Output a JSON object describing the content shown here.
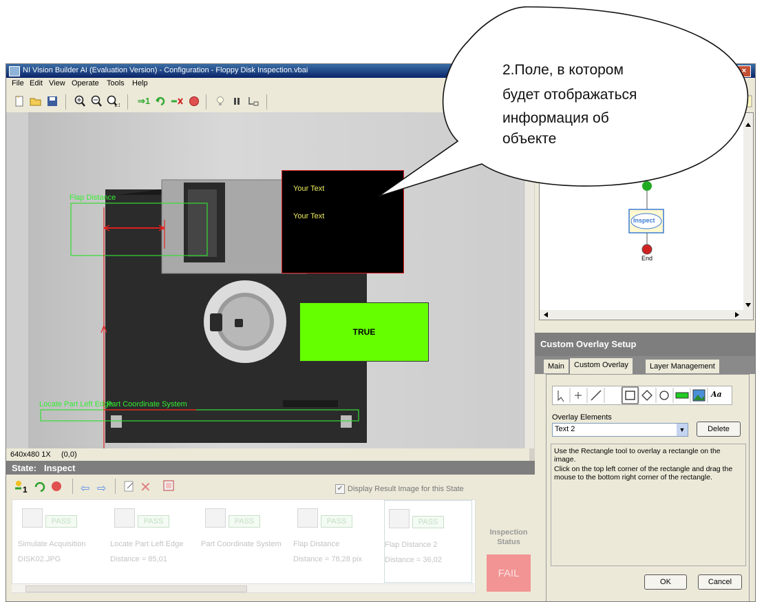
{
  "window": {
    "title": "NI Vision Builder AI (Evaluation Version) - Configuration - Floppy Disk Inspection.vbai",
    "close": "×"
  },
  "menu": [
    "File",
    "Edit",
    "View",
    "Operate",
    "Tools",
    "Help"
  ],
  "toolbar": {
    "icons": [
      "new-icon",
      "open-icon",
      "save-icon",
      "zoom-in-icon",
      "zoom-out-icon",
      "zoom-1to1-icon",
      "run-once-icon",
      "run-continuous-icon",
      "run-selected-icon",
      "stop-icon",
      "light-icon",
      "pause-icon",
      "step-icon",
      "help-icon"
    ],
    "run_label": "⇒1"
  },
  "overlay": {
    "flap_distance_label": "Flap Distance",
    "locate_label": "Locate Part Left Edge",
    "coordinate_label": "Part Coordinate System",
    "text_box_line1": "Your Text",
    "text_box_line2": "Your Text",
    "true_box": "TRUE",
    "colors": {
      "accent_green": "#66ff00",
      "text_yellow": "#f0f060",
      "overlay_red": "#e02020",
      "roi_green": "#33dd33"
    }
  },
  "status": {
    "resolution": "640x480 1X",
    "coords": "(0,0)"
  },
  "flowchart": {
    "inspect": "Inspect",
    "end": "End"
  },
  "setup": {
    "header": "Custom Overlay Setup",
    "tabs": [
      "Main",
      "Custom Overlay",
      "Layer Management"
    ],
    "tools": [
      "pointer-icon",
      "crosshair-icon",
      "line-icon",
      "rectangle-icon",
      "diamond-icon",
      "circle-icon",
      "fill-rect-icon",
      "image-icon",
      "text-tool-icon"
    ],
    "text_tool_label": "Aa",
    "overlay_elements_label": "Overlay Elements",
    "overlay_elements_value": "Text 2",
    "delete": "Delete",
    "help_text_1": "Use the Rectangle tool to overlay a rectangle on the image.",
    "help_text_2": "Click on the top left corner of the rectangle and drag the mouse to the bottom right corner of the rectangle.",
    "ok": "OK",
    "cancel": "Cancel"
  },
  "state": {
    "header": "State:   Inspect",
    "display_result": "Display Result Image for this State",
    "steps": [
      {
        "name": "Simulate Acquisition",
        "status": "PASS",
        "value": "DISK02.JPG"
      },
      {
        "name": "Locate Part Left Edge",
        "status": "PASS",
        "value": "Distance = 85,01"
      },
      {
        "name": "Part Coordinate System",
        "status": "PASS",
        "value": ""
      },
      {
        "name": "Flap Distance",
        "status": "PASS",
        "value": "Distance = 78,28 pix"
      },
      {
        "name": "Flap Distance 2",
        "status": "PASS",
        "value": "Distance = 36,02"
      }
    ],
    "inspection_status_line1": "Inspection",
    "inspection_status_line2": "Status",
    "inspection_result": "FAIL"
  },
  "callout": {
    "line1": "2.Поле, в котором",
    "line2": "будет отображаться",
    "line3": "информация об",
    "line4": "объекте"
  }
}
